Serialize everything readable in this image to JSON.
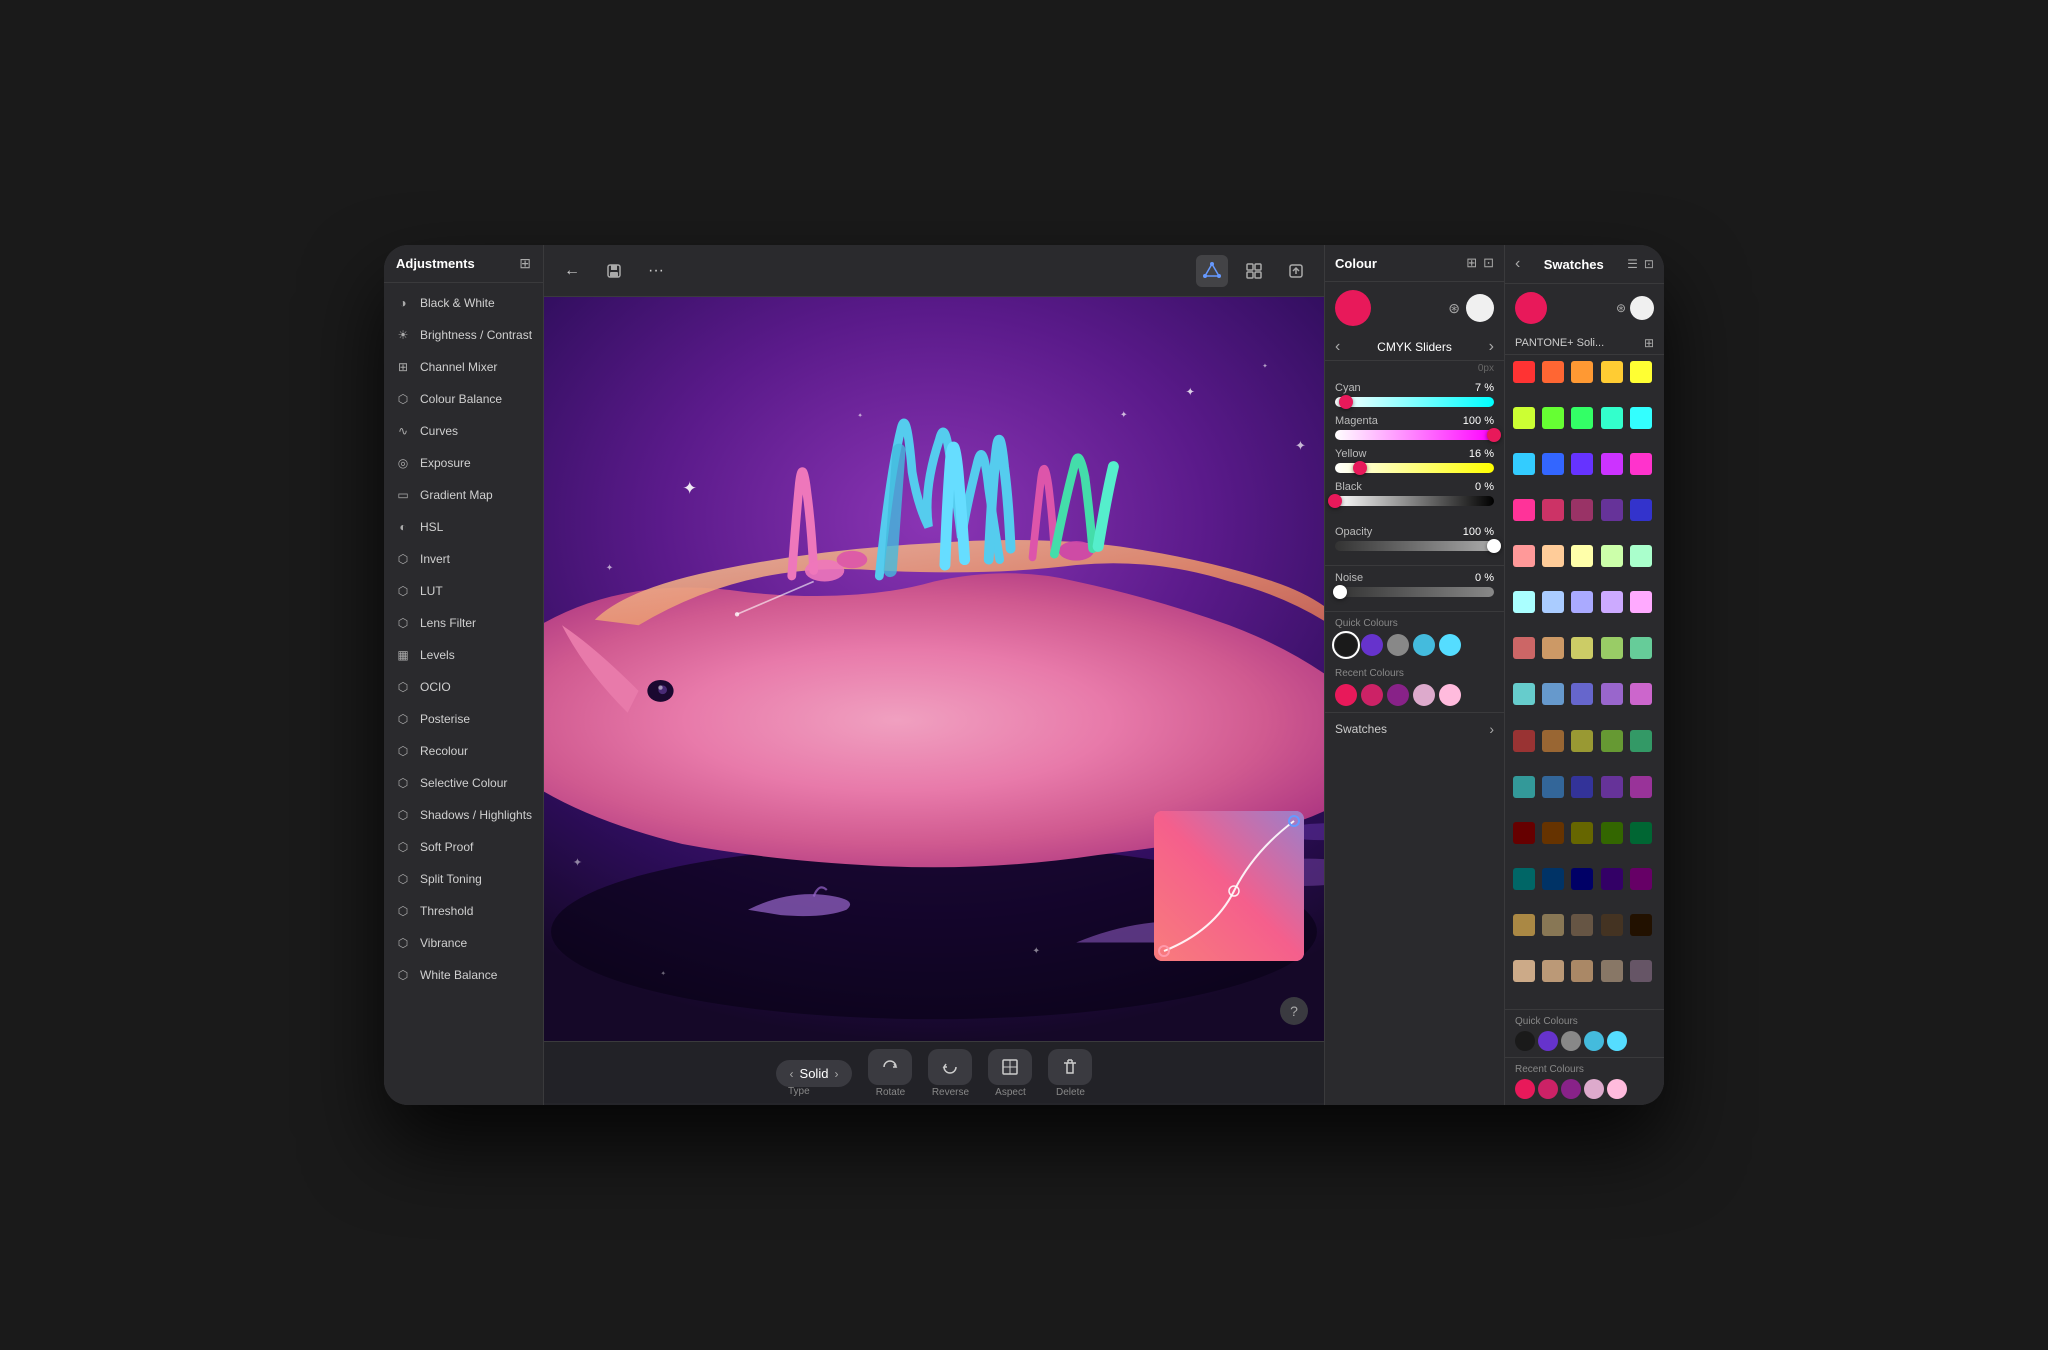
{
  "leftPanel": {
    "title": "Adjustments",
    "items": [
      {
        "label": "Black & White",
        "icon": "◑"
      },
      {
        "label": "Brightness / Contrast",
        "icon": "☀"
      },
      {
        "label": "Channel Mixer",
        "icon": "⊞"
      },
      {
        "label": "Colour Balance",
        "icon": "⬡"
      },
      {
        "label": "Curves",
        "icon": "∿"
      },
      {
        "label": "Exposure",
        "icon": "◎"
      },
      {
        "label": "Gradient Map",
        "icon": "▭"
      },
      {
        "label": "HSL",
        "icon": "◐"
      },
      {
        "label": "Invert",
        "icon": "⬡"
      },
      {
        "label": "LUT",
        "icon": "⬡"
      },
      {
        "label": "Lens Filter",
        "icon": "⬡"
      },
      {
        "label": "Levels",
        "icon": "▦"
      },
      {
        "label": "OCIO",
        "icon": "⬡"
      },
      {
        "label": "Posterise",
        "icon": "⬡"
      },
      {
        "label": "Recolour",
        "icon": "⬡"
      },
      {
        "label": "Selective Colour",
        "icon": "⬡"
      },
      {
        "label": "Shadows / Highlights",
        "icon": "⬡"
      },
      {
        "label": "Soft Proof",
        "icon": "⬡"
      },
      {
        "label": "Split Toning",
        "icon": "⬡"
      },
      {
        "label": "Threshold",
        "icon": "⬡"
      },
      {
        "label": "Vibrance",
        "icon": "⬡"
      },
      {
        "label": "White Balance",
        "icon": "⬡"
      }
    ]
  },
  "toolbar": {
    "back": "←",
    "save": "💾",
    "more": "···",
    "grid": "⊞",
    "export": "⬡"
  },
  "bottomBar": {
    "type": "Type",
    "typeValue": "Solid",
    "rotate": "Rotate",
    "reverse": "Reverse",
    "aspect": "Aspect",
    "delete": "Delete"
  },
  "colourPanel": {
    "title": "Colour",
    "primaryColor": "#e8195a",
    "secondaryColor": "#f0f0f0",
    "mode": "CMYK Sliders",
    "sliders": [
      {
        "label": "Cyan",
        "value": "7 %",
        "percent": 7,
        "gradient": "linear-gradient(to right, #ffffff, #00ffff)"
      },
      {
        "label": "Magenta",
        "value": "100 %",
        "percent": 100,
        "gradient": "linear-gradient(to right, #ffffff, #ff00ff)"
      },
      {
        "label": "Yellow",
        "value": "16 %",
        "percent": 16,
        "gradient": "linear-gradient(to right, #ffffff, #ffff00)"
      },
      {
        "label": "Black",
        "value": "0 %",
        "percent": 0,
        "gradient": "linear-gradient(to right, #ffffff, #000000)"
      }
    ],
    "opacity": {
      "label": "Opacity",
      "value": "100 %",
      "percent": 100
    },
    "noise": {
      "label": "Noise",
      "value": "0 %",
      "percent": 0
    },
    "quickColors": [
      "#1a1a1a",
      "#6633cc",
      "#888888",
      "#44bbdd",
      "#55ddff"
    ],
    "recentColors": [
      "#e8195a",
      "#cc2266",
      "#882288",
      "#ddaacc",
      "#ffbbdd"
    ],
    "swatchesLabel": "Swatches"
  },
  "swatchesPanel": {
    "title": "Swatches",
    "paletteName": "PANTONE+ Soli...",
    "primaryColor": "#e8195a",
    "secondaryColor": "#f0f0f0",
    "colors": [
      "#ff3333",
      "#ff6633",
      "#ff9933",
      "#ffcc33",
      "#ffff33",
      "#ccff33",
      "#66ff33",
      "#33ff66",
      "#33ffcc",
      "#33ffff",
      "#33ccff",
      "#3366ff",
      "#6633ff",
      "#cc33ff",
      "#ff33cc",
      "#ff3399",
      "#cc3366",
      "#993366",
      "#663399",
      "#3333cc",
      "#ff9999",
      "#ffcc99",
      "#ffffaa",
      "#ccffaa",
      "#aaffcc",
      "#aaffff",
      "#aaccff",
      "#aaaaff",
      "#ccaaff",
      "#ffaaff",
      "#cc6666",
      "#cc9966",
      "#cccc66",
      "#99cc66",
      "#66cc99",
      "#66cccc",
      "#6699cc",
      "#6666cc",
      "#9966cc",
      "#cc66cc",
      "#993333",
      "#996633",
      "#999933",
      "#669933",
      "#339966",
      "#339999",
      "#336699",
      "#333399",
      "#663399",
      "#993399",
      "#660000",
      "#663300",
      "#666600",
      "#336600",
      "#006633",
      "#006666",
      "#003366",
      "#000066",
      "#330066",
      "#660066",
      "#aa8844",
      "#887755",
      "#665544",
      "#443322",
      "#221100",
      "#ccaa88",
      "#bb9977",
      "#aa8866",
      "#887766",
      "#665566"
    ],
    "quickColors": [
      "#1a1a1a",
      "#6633cc",
      "#888888",
      "#44bbdd",
      "#55ddff"
    ],
    "recentColors": [
      "#e8195a",
      "#cc2266",
      "#882288",
      "#ddaacc",
      "#ffbbdd"
    ]
  }
}
